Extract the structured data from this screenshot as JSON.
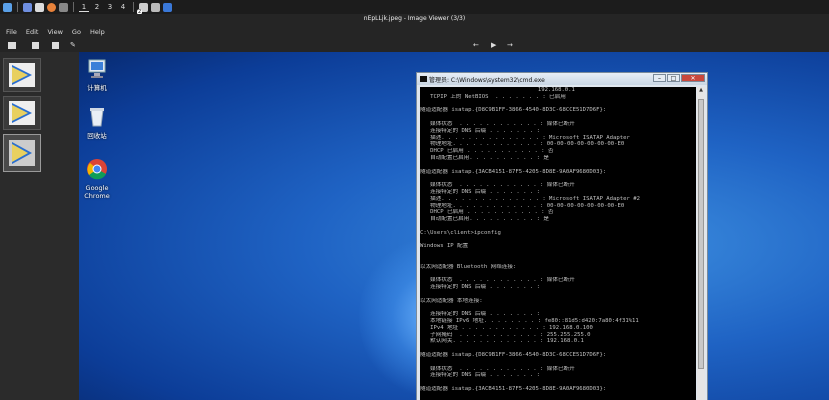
{
  "taskbar": {
    "workspaces": [
      "1",
      "2",
      "3",
      "4"
    ],
    "active_workspace": "1",
    "tray_badge": "2"
  },
  "window": {
    "title": "nEpLLjk.jpeg - Image Viewer (3/3)"
  },
  "menu": [
    "File",
    "Edit",
    "View",
    "Go",
    "Help"
  ],
  "toolbar": {
    "prev": "←",
    "play": "▶",
    "next": "→"
  },
  "desktop_icons": [
    {
      "label": "计算机",
      "icon": "computer-icon"
    },
    {
      "label": "回收站",
      "icon": "recycle-bin-icon"
    },
    {
      "label": "Google Chrome",
      "icon": "chrome-icon"
    }
  ],
  "cmd": {
    "title": "管理员: C:\\Windows\\system32\\cmd.exe",
    "lines": [
      "                                   192.168.0.1",
      "   TCPIP 上的 NetBIOS  . . . . . . . : 已启用",
      "",
      "隧道适配器 isatap.{D8C9B1FF-3866-4540-8D3C-68CCE51D7D6F}:",
      "",
      "   媒体状态  . . . . . . . . . . . . : 媒体已断开",
      "   连接特定的 DNS 后缀 . . . . . . . :",
      "   描述. . . . . . . . . . . . . . . : Microsoft ISATAP Adapter",
      "   物理地址. . . . . . . . . . . . . : 00-00-00-00-00-00-00-E0",
      "   DHCP 已启用 . . . . . . . . . . . : 否",
      "   自动配置已启用. . . . . . . . . . : 是",
      "",
      "隧道适配器 isatap.{3ACB4151-87F5-4205-8D8E-9A0AF9680D03}:",
      "",
      "   媒体状态  . . . . . . . . . . . . : 媒体已断开",
      "   连接特定的 DNS 后缀 . . . . . . . :",
      "   描述. . . . . . . . . . . . . . . : Microsoft ISATAP Adapter #2",
      "   物理地址. . . . . . . . . . . . . : 00-00-00-00-00-00-00-E0",
      "   DHCP 已启用 . . . . . . . . . . . : 否",
      "   自动配置已启用. . . . . . . . . . : 是",
      "",
      "C:\\Users\\client>ipconfig",
      "",
      "Windows IP 配置",
      "",
      "",
      "以太网适配器 Bluetooth 网络连接:",
      "",
      "   媒体状态  . . . . . . . . . . . . : 媒体已断开",
      "   连接特定的 DNS 后缀 . . . . . . . :",
      "",
      "以太网适配器 本地连接:",
      "",
      "   连接特定的 DNS 后缀 . . . . . . . :",
      "   本地链接 IPv6 地址. . . . . . . . : fe80::81d5:d420:7a80:4f31%11",
      "   IPv4 地址 . . . . . . . . . . . . : 192.168.0.100",
      "   子网掩码  . . . . . . . . . . . . : 255.255.255.0",
      "   默认网关. . . . . . . . . . . . . : 192.168.0.1",
      "",
      "隧道适配器 isatap.{D8C9B1FF-3866-4540-8D3C-68CCE51D7D6F}:",
      "",
      "   媒体状态  . . . . . . . . . . . . : 媒体已断开",
      "   连接特定的 DNS 后缀 . . . . . . . :",
      "",
      "隧道适配器 isatap.{3ACB4151-87F5-4205-8D8E-9A0AF9680D03}:",
      ""
    ]
  }
}
